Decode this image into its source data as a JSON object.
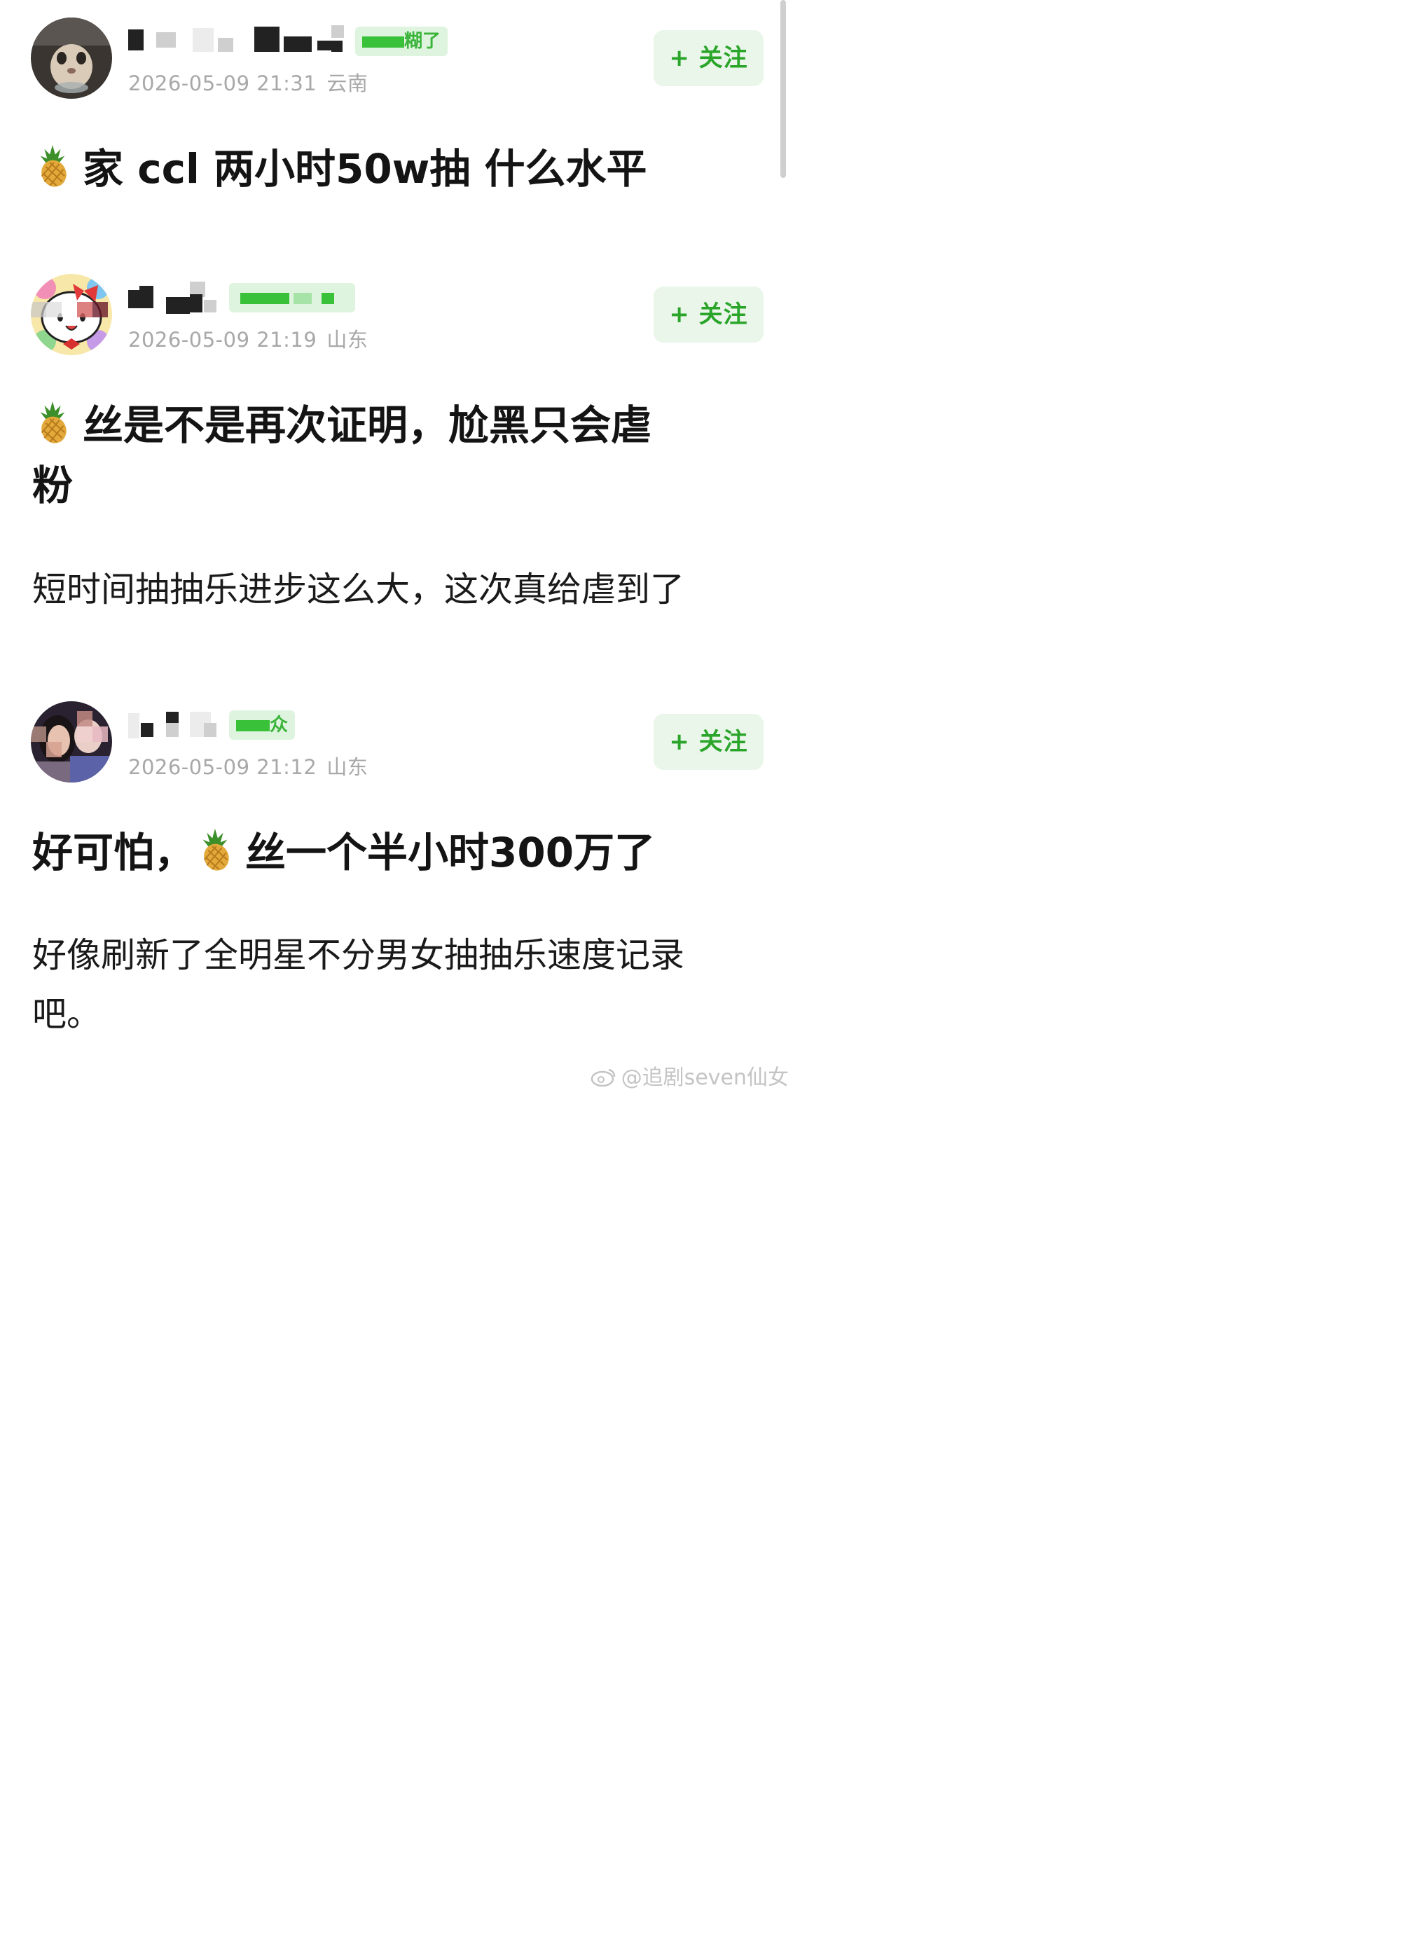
{
  "colors": {
    "accent_green": "#2aa52a",
    "follow_bg": "#eaf6ea",
    "badge_bg": "#dff4df",
    "meta_gray": "#a8a8a8"
  },
  "posts": [
    {
      "badge": "糊了",
      "timestamp": "2026-05-09 21:31",
      "location": "云南",
      "follow_label": "+ 关注",
      "title": "家 ccl 两小时50w抽 什么水平",
      "title_icon": "pineapple-emoji"
    },
    {
      "badge": "",
      "timestamp": "2026-05-09 21:19",
      "location": "山东",
      "follow_label": "+ 关注",
      "title_line1": "丝是不是再次证明，尬黑只会虐",
      "title_line2": "粉",
      "title_icon": "pineapple-emoji",
      "body": "短时间抽抽乐进步这么大，这次真给虐到了"
    },
    {
      "badge": "众",
      "timestamp": "2026-05-09 21:12",
      "location": "山东",
      "follow_label": "+ 关注",
      "title_prefix": "好可怕，",
      "title_suffix": "丝一个半小时300万了",
      "title_icon": "pineapple-emoji",
      "body_line1": "好像刷新了全明星不分男女抽抽乐速度记录",
      "body_line2": "吧。"
    }
  ],
  "watermark": "@追剧seven仙女"
}
